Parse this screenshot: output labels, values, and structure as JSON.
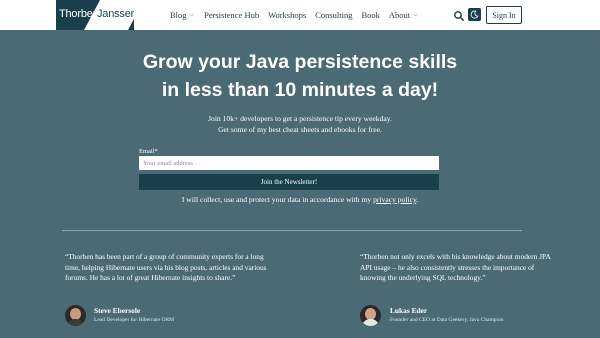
{
  "header": {
    "logo_first": "Thorben",
    "logo_last": "Janssen",
    "nav": [
      {
        "label": "Blog",
        "chevron": true
      },
      {
        "label": "Persistence Hub",
        "chevron": false
      },
      {
        "label": "Workshops",
        "chevron": false
      },
      {
        "label": "Consulting",
        "chevron": false
      },
      {
        "label": "Book",
        "chevron": false
      },
      {
        "label": "About",
        "chevron": true
      }
    ],
    "search_icon": "search-icon",
    "theme_icon": "moon-icon",
    "signin_label": "Sign In"
  },
  "hero": {
    "headline_line1": "Grow your Java persistence skills",
    "headline_line2": "in less than 10 minutes a day!",
    "sub_line1": "Join 10k+ developers to get a persistence tip every weekday.",
    "sub_line2": "Get some of my best cheat sheets and ebooks for free.",
    "email_label": "Email",
    "email_required": "*",
    "email_value": "",
    "email_placeholder": "Your email address",
    "join_label": "Join the Newsletter!",
    "privacy_text": "I will collect, use and protect your data in accordance with my ",
    "privacy_link": "privacy policy",
    "privacy_end": "."
  },
  "testimonials": [
    {
      "quote": "“Thorben has been part of a group of community experts for a long time, helping Hibernate users via his blog posts, articles and various forums. He has a lot of great Hibernate insights to share.”",
      "name": "Steve Ebersole",
      "title": "Lead Developer for Hibernate ORM"
    },
    {
      "quote": "“Thorben not only excels with his knowledge about modern JPA API usage – he also consistently stresses the importance of knowing the underlying SQL technology.”",
      "name": "Lukas Eder",
      "title": "Founder and CEO at Data Geekery, Java Champion"
    }
  ],
  "colors": {
    "background": "#4b6a75",
    "brand_dark": "#193f4c",
    "header_bg": "#ffffff"
  }
}
